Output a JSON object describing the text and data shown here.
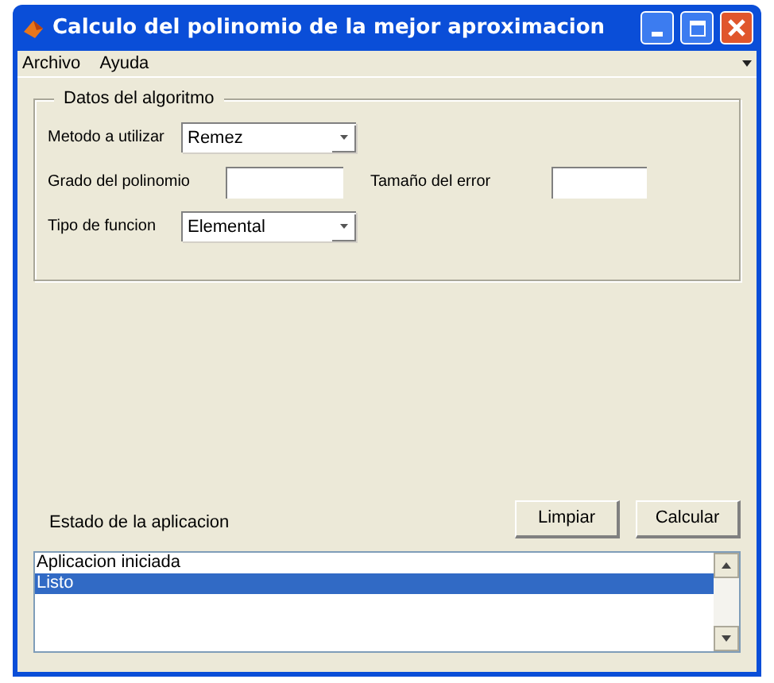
{
  "window": {
    "title": "Calculo del polinomio de la mejor aproximacion"
  },
  "menu": [
    "Archivo",
    "Ayuda"
  ],
  "panel": {
    "legend": "Datos del algoritmo",
    "rows": [
      [
        {
          "kind": "dropdown",
          "label": "Metodo a utilizar",
          "value": "Remez"
        }
      ],
      [
        {
          "kind": "text",
          "label": "Grado del polinomio"
        },
        {
          "kind": "text",
          "label": "Tamaño del error"
        }
      ],
      [
        {
          "kind": "dropdown",
          "label": "Tipo de funcion",
          "value": "Elemental"
        }
      ]
    ]
  },
  "status_label": "Estado de la aplicacion",
  "buttons": [
    "Limpiar",
    "Calcular"
  ],
  "log": [
    {
      "text": "Aplicacion iniciada",
      "selected": false
    },
    {
      "text": "Listo",
      "selected": true
    }
  ]
}
